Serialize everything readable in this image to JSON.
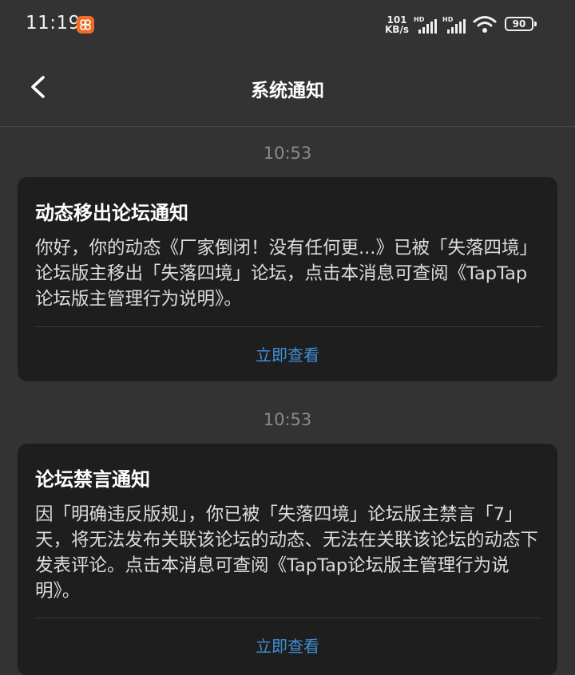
{
  "status_bar": {
    "time": "11:19",
    "net_speed_value": "101",
    "net_speed_unit": "KB/s",
    "signal_1_label": "HD",
    "signal_2_label": "HD",
    "battery": "90"
  },
  "header": {
    "title": "系统通知"
  },
  "notifications": [
    {
      "time": "10:53",
      "title": "动态移出论坛通知",
      "body": "你好，你的动态《厂家倒闭！没有任何更...》已被「失落四境」论坛版主移出「失落四境」论坛，点击本消息可查阅《TapTap论坛版主管理行为说明》。",
      "action": "立即查看"
    },
    {
      "time": "10:53",
      "title": "论坛禁言通知",
      "body": "因「明确违反版规」，你已被「失落四境」论坛版主禁言「7」天，将无法发布关联该论坛的动态、无法在关联该论坛的动态下发表评论。点击本消息可查阅《TapTap论坛版主管理行为说明》。",
      "action": "立即查看"
    }
  ],
  "colors": {
    "background": "#333333",
    "card": "#1e1e1e",
    "accent": "#3f8fd6",
    "app_badge": "#f26b24"
  },
  "icons": {
    "back": "back-arrow-icon",
    "app": "app-badge-icon",
    "signal": "signal-strength-icon",
    "wifi": "wifi-icon",
    "battery": "battery-icon"
  }
}
